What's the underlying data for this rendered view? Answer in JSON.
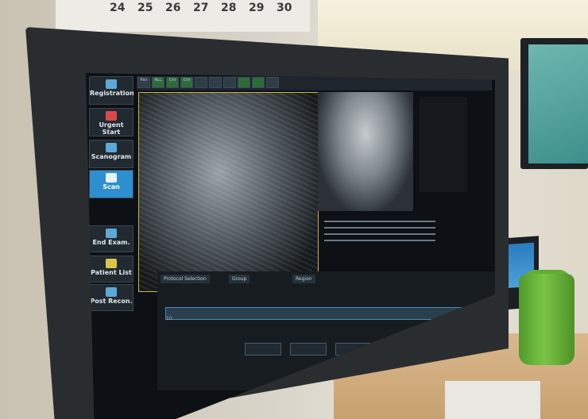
{
  "calendar": {
    "dates": [
      "24",
      "25",
      "26",
      "27",
      "28",
      "29",
      "30"
    ]
  },
  "sidebar": {
    "items": [
      {
        "label": "Registration"
      },
      {
        "label": "Urgent Start"
      },
      {
        "label": "Scanogram"
      },
      {
        "label": "Scan"
      },
      {
        "label": "End Exam."
      },
      {
        "label": "Patient List"
      },
      {
        "label": "Post Recon."
      }
    ]
  },
  "toolbar": {
    "items": [
      "Pan",
      "ALL",
      "Cnt",
      "Cnt"
    ]
  },
  "panel": {
    "tab_protocol": "Protocol Selection",
    "tab_group": "Group",
    "tab_region": "Region",
    "row_no": "10"
  },
  "colors": {
    "active": "#2d8ed0",
    "frame": "#c9b342",
    "bottle": "#6fbe3a"
  }
}
